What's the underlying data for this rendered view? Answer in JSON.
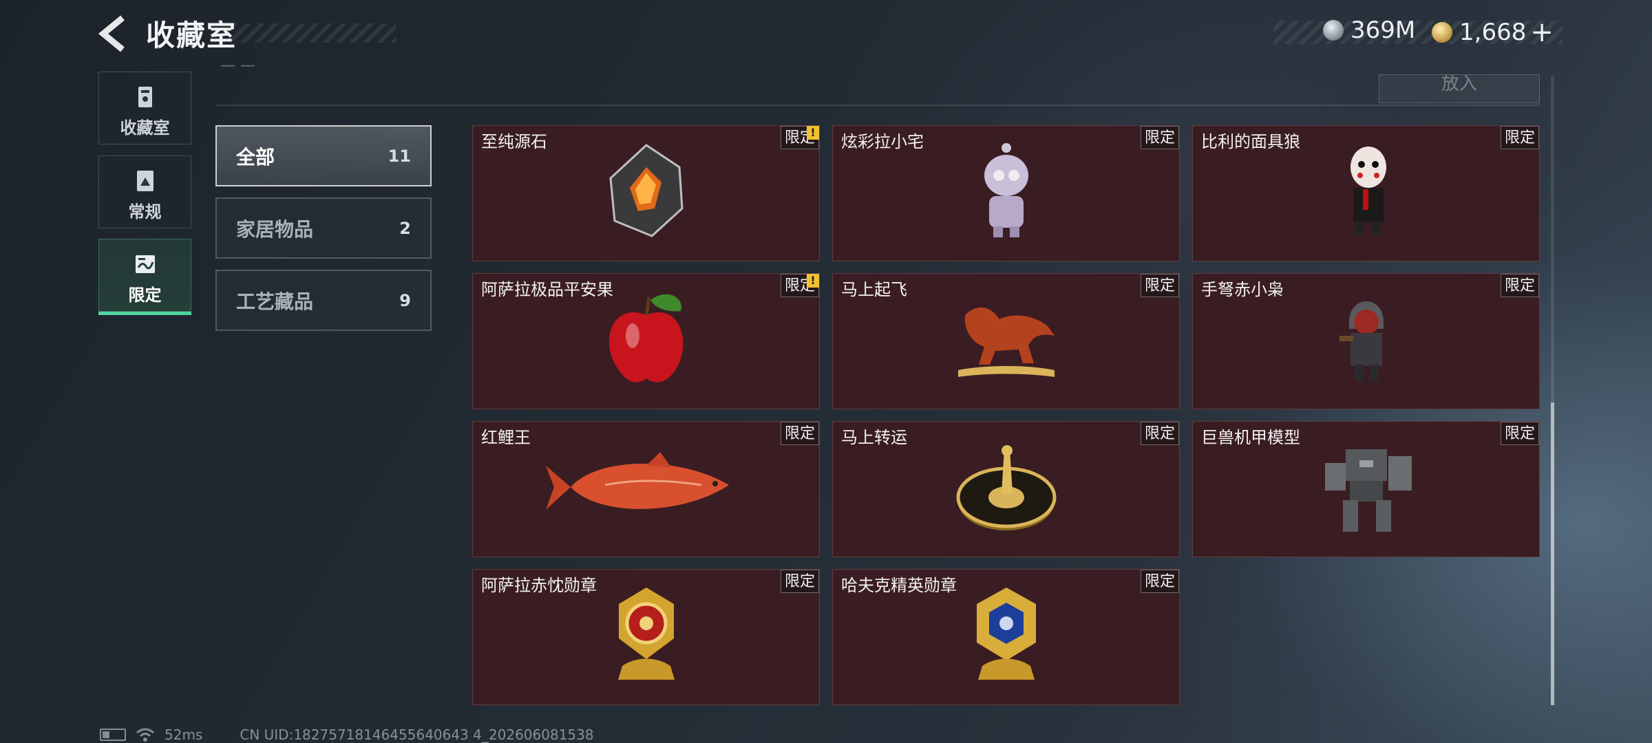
{
  "header": {
    "title": "收藏室",
    "currency_silver": "369M",
    "currency_gold": "1,668",
    "add_symbol": "+"
  },
  "side_nav": [
    {
      "label": "收藏室",
      "icon": "collection-icon"
    },
    {
      "label": "常规",
      "icon": "document-icon"
    },
    {
      "label": "限定",
      "icon": "limited-icon",
      "active": true
    }
  ],
  "toolbar": {
    "put_in_label": "放入"
  },
  "filters": [
    {
      "label": "全部",
      "count": "11",
      "active": true
    },
    {
      "label": "家居物品",
      "count": "2"
    },
    {
      "label": "工艺藏品",
      "count": "9"
    }
  ],
  "items": [
    {
      "name": "至纯源石",
      "tag": "限定",
      "alert": "!"
    },
    {
      "name": "炫彩拉小宅",
      "tag": "限定"
    },
    {
      "name": "比利的面具狼",
      "tag": "限定"
    },
    {
      "name": "阿萨拉极品平安果",
      "tag": "限定",
      "alert": "!"
    },
    {
      "name": "马上起飞",
      "tag": "限定"
    },
    {
      "name": "手弩赤小枭",
      "tag": "限定"
    },
    {
      "name": "红鲤王",
      "tag": "限定"
    },
    {
      "name": "马上转运",
      "tag": "限定"
    },
    {
      "name": "巨兽机甲模型",
      "tag": "限定"
    },
    {
      "name": "阿萨拉赤忱勋章",
      "tag": "限定"
    },
    {
      "name": "哈夫克精英勋章",
      "tag": "限定"
    }
  ],
  "footer": {
    "ping": "52ms",
    "uid": "CN UID:18275718146455640643 4_202606081538"
  },
  "colors": {
    "card_bg": "#3a1d22",
    "active_accent": "#4fd6a0",
    "alert": "#f2c230"
  }
}
